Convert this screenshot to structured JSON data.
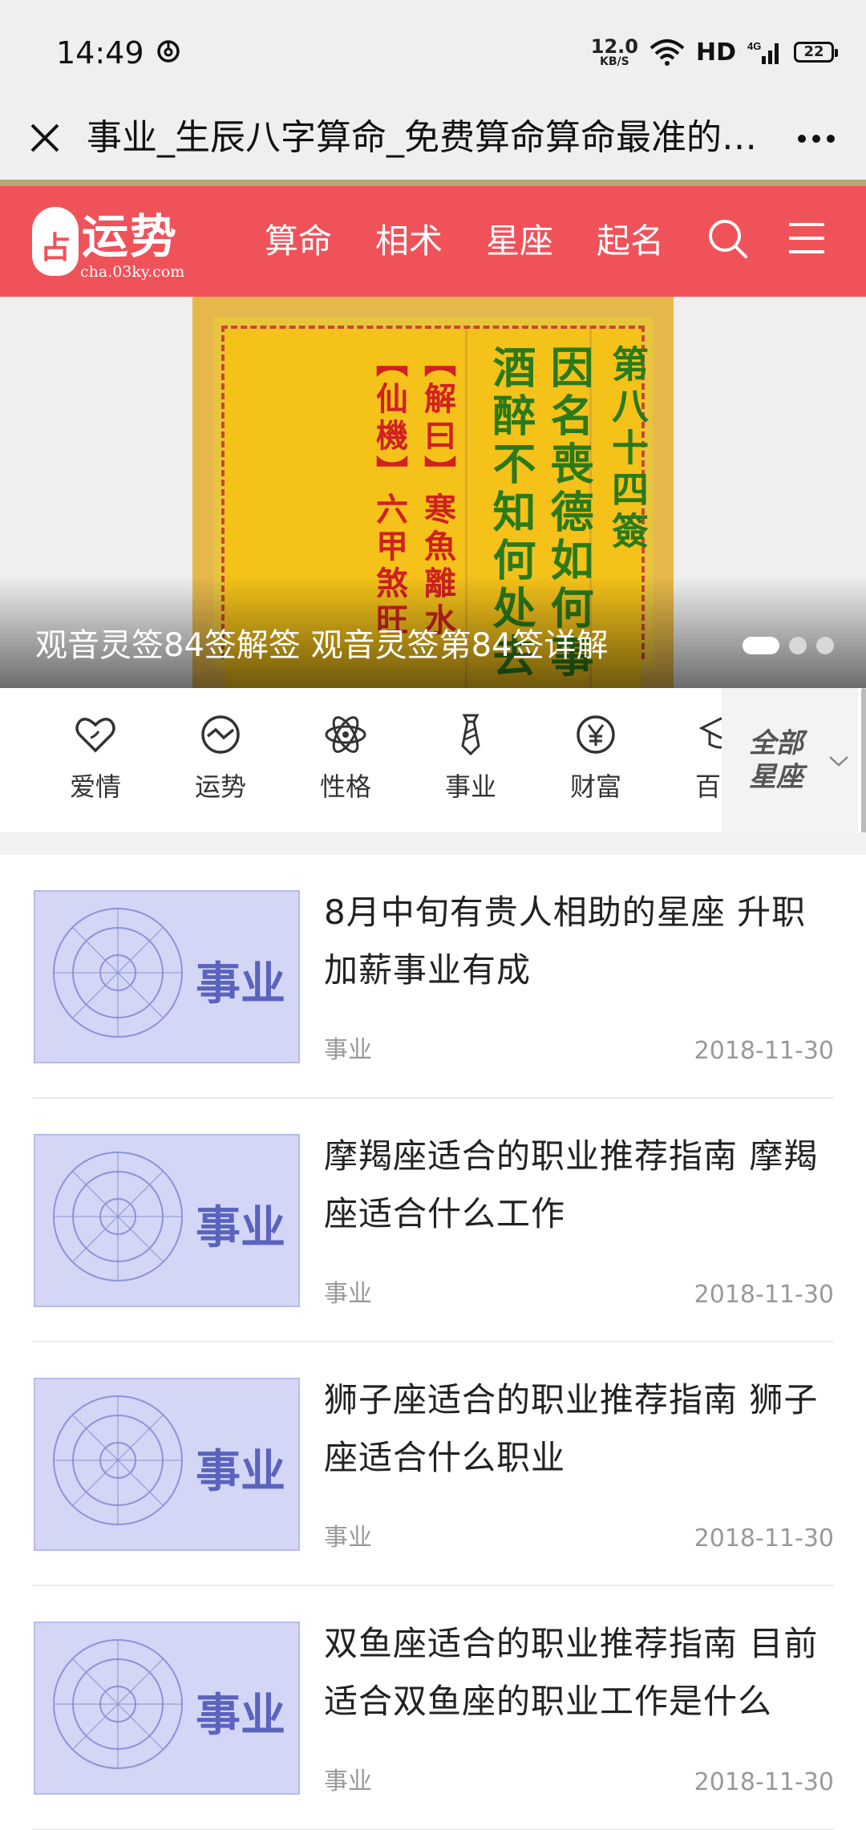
{
  "status_bar": {
    "time": "14:49",
    "net_speed_value": "12.0",
    "net_speed_unit": "KB/S",
    "network_type": "HD",
    "signal_label": "4G",
    "battery": "22"
  },
  "title_bar": {
    "title": "事业_生辰八字算命_免费算命算命最准的网站",
    "close_icon": "close-icon",
    "more_icon": "more-icon"
  },
  "header": {
    "brand_mark": "占",
    "brand_name": "运势",
    "brand_url": "cha.03ky.com",
    "nav": [
      "算命",
      "相术",
      "星座",
      "起名"
    ],
    "accent_color": "#f0525a"
  },
  "banner": {
    "caption": "观音灵签84签解签 观音灵签第84签详解",
    "slip_columns": [
      {
        "text": "第八十四簽",
        "color": "#2a7a1a"
      },
      {
        "text": "因名喪德如何事",
        "color": "#2a7a1a"
      },
      {
        "text": "酒醉不知何处去",
        "color": "#2a7a1a"
      },
      {
        "text": "【解曰】寒魚離水",
        "color": "#d02020"
      },
      {
        "text": "【仙機】六甲煞旺",
        "color": "#d02020"
      }
    ],
    "dot_count": 3,
    "active_dot": 0
  },
  "categories": {
    "items": [
      {
        "label": "爱情",
        "icon": "heart-icon"
      },
      {
        "label": "运势",
        "icon": "trend-icon"
      },
      {
        "label": "性格",
        "icon": "atom-icon"
      },
      {
        "label": "事业",
        "icon": "tie-icon"
      },
      {
        "label": "财富",
        "icon": "yen-icon"
      },
      {
        "label": "百科",
        "icon": "graduation-cap-icon"
      }
    ],
    "all_button": "全部星座"
  },
  "articles": [
    {
      "title": "8月中旬有贵人相助的星座 升职加薪事业有成",
      "tag": "事业",
      "date": "2018-11-30",
      "thumb_word": "事业"
    },
    {
      "title": "摩羯座适合的职业推荐指南 摩羯座适合什么工作",
      "tag": "事业",
      "date": "2018-11-30",
      "thumb_word": "事业"
    },
    {
      "title": "狮子座适合的职业推荐指南 狮子座适合什么职业",
      "tag": "事业",
      "date": "2018-11-30",
      "thumb_word": "事业"
    },
    {
      "title": "双鱼座适合的职业推荐指南 目前适合双鱼座的职业工作是什么",
      "tag": "事业",
      "date": "2018-11-30",
      "thumb_word": "事业"
    }
  ]
}
